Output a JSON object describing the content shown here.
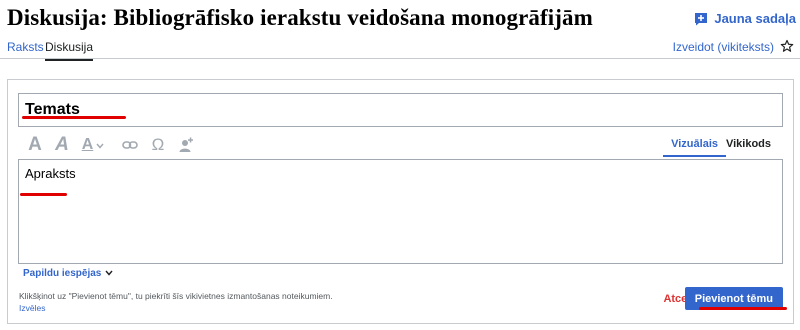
{
  "page": {
    "title": "Diskusija: Bibliogrāfisko ierakstu veidošana monogrāfijām"
  },
  "header": {
    "new_section_label": "Jauna sadaļa",
    "new_section_icon": "speech-bubble-add-icon",
    "tabs": [
      {
        "label": "Raksts"
      },
      {
        "label": "Diskusija"
      }
    ],
    "create_label": "Izveidot (vikiteksts)",
    "watch_icon": "star-icon"
  },
  "form": {
    "title_placeholder": "Temats",
    "toolbar": {
      "bold": "A",
      "italic": "A",
      "style": "A",
      "special_char": "Ω"
    },
    "mode_tabs": [
      {
        "label": "Vizuālais",
        "active": true
      },
      {
        "label": "Vikikods",
        "active": false
      }
    ],
    "description_placeholder": "Apraksts",
    "options_label": "Papildu iespējas",
    "legal_text": "Klikšķinot uz \"Pievienot tēmu\", tu piekrīti šīs vikivietnes izmantošanas noteikumiem.",
    "help_label": "Izvēles",
    "cancel_label": "Atcelt",
    "submit_label": "Pievienot tēmu"
  },
  "colors": {
    "link": "#3366cc",
    "primary_button": "#3366cc",
    "destructive": "#dd3333",
    "annotation": "#e00000"
  }
}
